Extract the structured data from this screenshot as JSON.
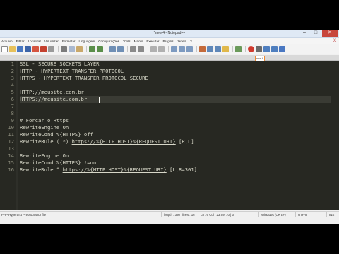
{
  "window": {
    "title": "*new 4 - Notepad++",
    "minimize_icon": "minimize-icon",
    "maximize_icon": "maximize-icon",
    "close_icon": "close-icon"
  },
  "menu": [
    "Arquivo",
    "Editar",
    "Localizar",
    "Visualizar",
    "Formatar",
    "Linguagem",
    "Configurações",
    "Tools",
    "Macro",
    "Executar",
    "Plugins",
    "Janela",
    "?"
  ],
  "menu_close": "X",
  "toolbar_icons": [
    "new-file-icon",
    "open-file-icon",
    "save-icon",
    "save-all-icon",
    "close-icon",
    "close-all-icon",
    "print-icon",
    "cut-icon",
    "copy-icon",
    "paste-icon",
    "undo-icon",
    "redo-icon",
    "find-icon",
    "replace-icon",
    "zoom-in-icon",
    "zoom-out-icon",
    "sync-vertical-icon",
    "sync-horizontal-icon",
    "word-wrap-icon",
    "show-all-chars-icon",
    "indent-guide-icon",
    "udl-icon",
    "doc-map-icon",
    "function-list-icon",
    "folder-workspace-icon",
    "monitoring-icon",
    "record-macro-icon",
    "stop-macro-icon",
    "play-macro-icon",
    "run-macro-multiple-icon",
    "save-macro-icon"
  ],
  "tab": {
    "label": "new 4 ✕"
  },
  "editor": {
    "lines": [
      {
        "n": "1",
        "text": "SSL - SECURE SOCKETS LAYER"
      },
      {
        "n": "2",
        "text": "HTTP - HYPERTEXT TRANSFER PROTOCOL"
      },
      {
        "n": "3",
        "text": "HTTPS - HYPERTEXT TRANSFER PROTOCOL SECURE"
      },
      {
        "n": "4",
        "text": ""
      },
      {
        "n": "5",
        "text": "HTTP://meusite.com.br"
      },
      {
        "n": "6",
        "text": "HTTPS://meusite.com.br"
      },
      {
        "n": "7",
        "text": ""
      },
      {
        "n": "8",
        "text": ""
      },
      {
        "n": "9",
        "text": "# Forçar o Https"
      },
      {
        "n": "10",
        "text": "RewriteEngine On"
      },
      {
        "n": "11",
        "text": "RewriteCond %{HTTPS} off"
      },
      {
        "n": "12",
        "text_pre": "RewriteRule (.*) ",
        "url": "https://%{HTTP_HOST}%{REQUEST_URI}",
        "text_post": " [R,L]"
      },
      {
        "n": "13",
        "text": ""
      },
      {
        "n": "14",
        "text": "RewriteEngine On"
      },
      {
        "n": "15",
        "text": "RewriteCond %{HTTPS} !=on"
      },
      {
        "n": "16",
        "text_pre": "RewriteRule ^ ",
        "url": "https://%{HTTP_HOST}%{REQUEST_URI}",
        "text_post": " [L,R=301]"
      }
    ]
  },
  "status": {
    "file_type": "PHP Hypertext Preprocessor file",
    "length": "length : 330",
    "lines": "lines : 16",
    "position": "Ln : 6   Col : 23   Sel : 0 | 0",
    "eol": "Windows (CR LF)",
    "encoding": "UTF-8",
    "mode": "INS"
  },
  "colors": {
    "editor_bg": "#272822",
    "text": "#d7d7c8",
    "line_numbers": "#8f8f7f",
    "tab_accent": "#f08a34"
  }
}
